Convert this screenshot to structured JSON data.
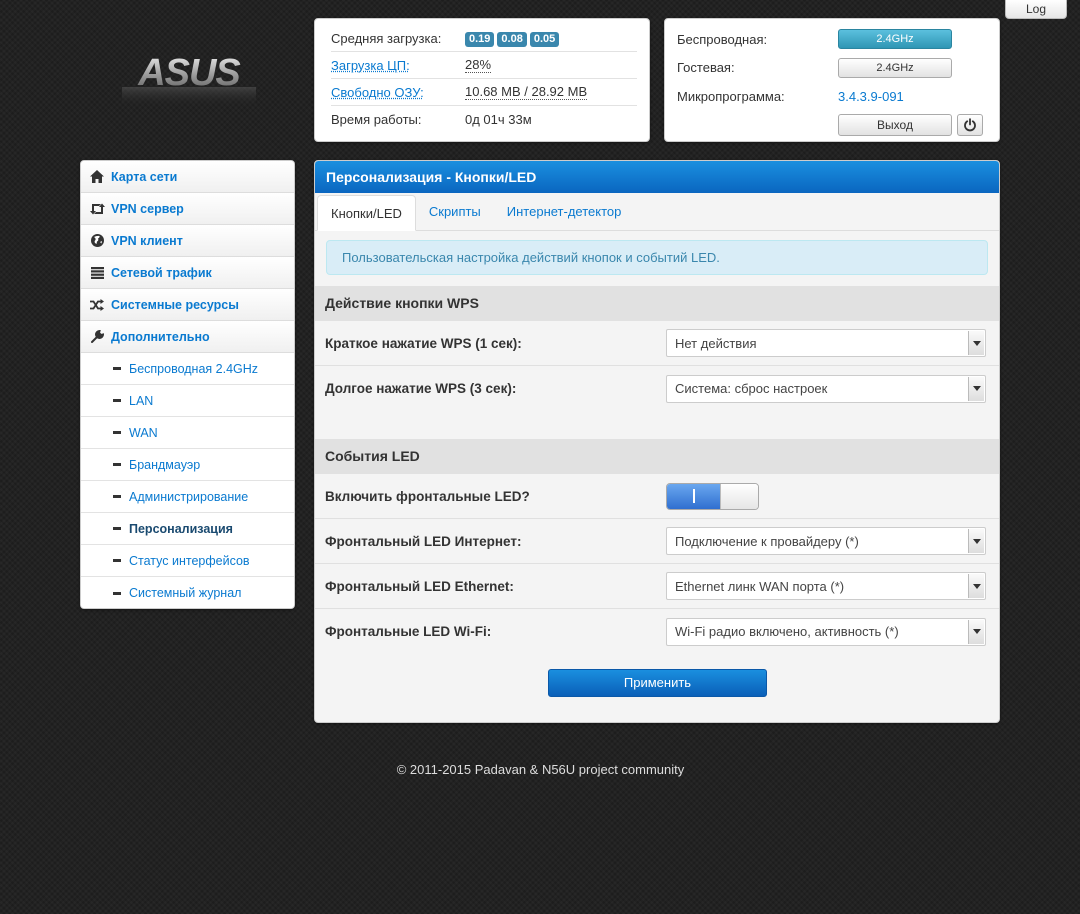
{
  "header": {
    "log_label": "Log",
    "logo_text": "ASUS"
  },
  "status": {
    "load_label": "Средняя загрузка:",
    "load_values": [
      "0.19",
      "0.08",
      "0.05"
    ],
    "cpu_label": "Загрузка ЦП:",
    "cpu_value": "28%",
    "ram_label": "Свободно ОЗУ:",
    "ram_value": "10.68 MB / 28.92 MB",
    "uptime_label": "Время работы:",
    "uptime_value": "0д 01ч 33м"
  },
  "wifi": {
    "wireless_label": "Беспроводная:",
    "wireless_btn": "2.4GHz",
    "guest_label": "Гостевая:",
    "guest_btn": "2.4GHz",
    "firmware_label": "Микропрограмма:",
    "firmware_value": "3.4.3.9-091",
    "exit_label": "Выход"
  },
  "sidebar": {
    "items": [
      {
        "label": "Карта сети",
        "icon": "home-icon"
      },
      {
        "label": "VPN сервер",
        "icon": "retweet-icon"
      },
      {
        "label": "VPN клиент",
        "icon": "globe-icon"
      },
      {
        "label": "Сетевой трафик",
        "icon": "list-icon"
      },
      {
        "label": "Системные ресурсы",
        "icon": "shuffle-icon"
      },
      {
        "label": "Дополнительно",
        "icon": "wrench-icon"
      }
    ],
    "sub_items": [
      "Беспроводная 2.4GHz",
      "LAN",
      "WAN",
      "Брандмауэр",
      "Администрирование",
      "Персонализация",
      "Статус интерфейсов",
      "Системный журнал"
    ]
  },
  "main": {
    "title": "Персонализация - Кнопки/LED",
    "tabs": [
      "Кнопки/LED",
      "Скрипты",
      "Интернет-детектор"
    ],
    "info": "Пользовательская настройка действий кнопок и событий LED.",
    "wps_section": "Действие кнопки WPS",
    "wps_short_label": "Краткое нажатие WPS (1 сек):",
    "wps_short_value": "Нет действия",
    "wps_long_label": "Долгое нажатие WPS (3 сек):",
    "wps_long_value": "Система: сброс настроек",
    "led_section": "События LED",
    "led_enable_label": "Включить фронтальные LED?",
    "led_internet_label": "Фронтальный LED Интернет:",
    "led_internet_value": "Подключение к провайдеру (*)",
    "led_ethernet_label": "Фронтальный LED Ethernet:",
    "led_ethernet_value": "Ethernet линк WAN порта (*)",
    "led_wifi_label": "Фронтальные LED Wi-Fi:",
    "led_wifi_value": "Wi-Fi радио включено, активность (*)",
    "apply_label": "Применить"
  },
  "footer": {
    "text": "© 2011-2015 Padavan & N56U project community"
  }
}
